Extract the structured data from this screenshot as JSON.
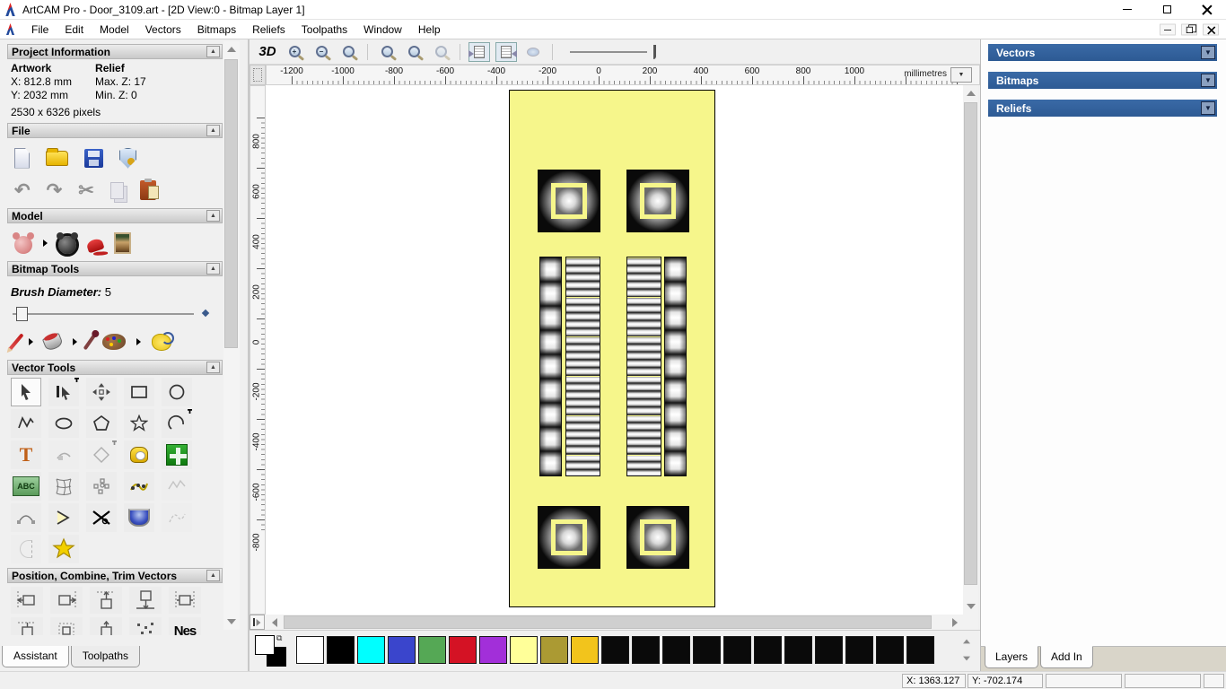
{
  "window": {
    "title": "ArtCAM Pro - Door_3109.art - [2D View:0 - Bitmap Layer 1]"
  },
  "menu": {
    "items": [
      "File",
      "Edit",
      "Model",
      "Vectors",
      "Bitmaps",
      "Reliefs",
      "Toolpaths",
      "Window",
      "Help"
    ]
  },
  "assistant": {
    "tabs": [
      "Assistant",
      "Toolpaths"
    ],
    "project_information": {
      "title": "Project Information",
      "artwork_label": "Artwork",
      "relief_label": "Relief",
      "x": "X: 812.8 mm",
      "y": "Y: 2032 mm",
      "pixels": "2530 x 6326 pixels",
      "max_z": "Max. Z: 17",
      "min_z": "Min. Z: 0"
    },
    "file_section": {
      "title": "File"
    },
    "model_section": {
      "title": "Model"
    },
    "bitmap_tools": {
      "title": "Bitmap Tools",
      "brush_label": "Brush Diameter:",
      "brush_value": "5"
    },
    "vector_tools": {
      "title": "Vector Tools"
    },
    "position_section": {
      "title": "Position, Combine, Trim Vectors",
      "nesting_label": "Nes"
    }
  },
  "toolbar": {
    "view_3d_label": "3D"
  },
  "ruler": {
    "h_ticks": [
      "-1200",
      "-1000",
      "-800",
      "-600",
      "-400",
      "-200",
      "0",
      "200",
      "400",
      "600",
      "800",
      "1000"
    ],
    "v_ticks": [
      "800",
      "600",
      "400",
      "200",
      "0",
      "-200",
      "-400",
      "-600",
      "-800"
    ],
    "units": "millimetres"
  },
  "right_panel": {
    "headers": [
      "Vectors",
      "Bitmaps",
      "Reliefs"
    ],
    "tabs": [
      "Layers",
      "Add In"
    ]
  },
  "palette": {
    "colors": [
      "#ffffff",
      "#000000",
      "#00ffff",
      "#3a45cc",
      "#55a855",
      "#d41224",
      "#a22fd9",
      "#ffff99",
      "#ab9a33",
      "#f2c41c",
      "#0a0a0a",
      "#0a0a0a",
      "#0a0a0a",
      "#0a0a0a",
      "#0a0a0a",
      "#0a0a0a",
      "#0a0a0a",
      "#0a0a0a",
      "#0a0a0a",
      "#0a0a0a",
      "#0a0a0a"
    ]
  },
  "status": {
    "x": "X: 1363.127",
    "y": "Y: -702.174"
  },
  "colors": {
    "accent_blue": "#31639c",
    "door_yellow": "#f6f68b"
  },
  "icons": {
    "collapse": "▲",
    "dropdown": "▼",
    "undo": "↶",
    "redo": "↷",
    "cut": "✂",
    "text_tool": "T",
    "abc": "ABC",
    "plus": "+",
    "minus": "−",
    "one_one": "1:1",
    "link": "⧉"
  }
}
